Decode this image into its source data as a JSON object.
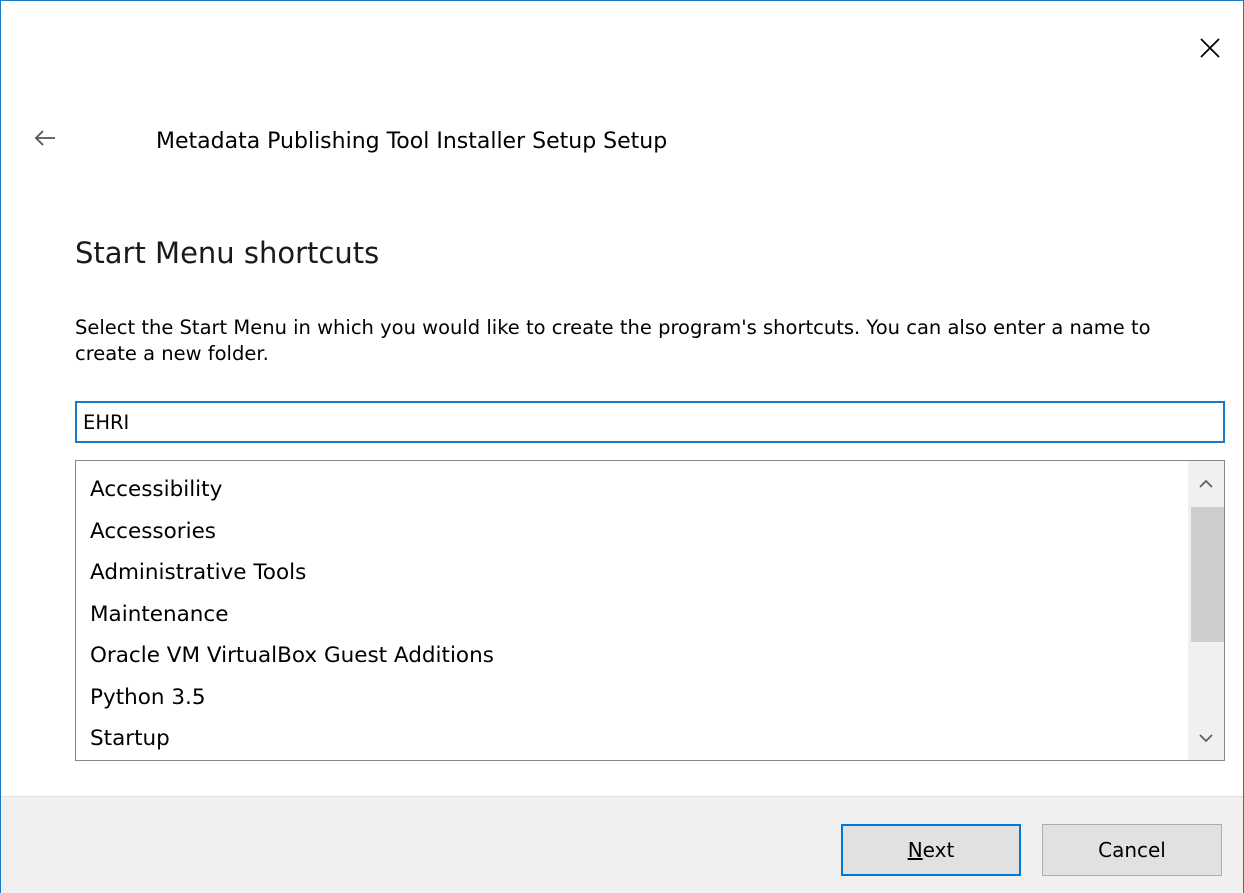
{
  "window": {
    "title": "Metadata Publishing Tool Installer Setup Setup",
    "close_icon": "close-icon",
    "back_icon": "back-arrow-icon",
    "accent_color": "#1979ca"
  },
  "page": {
    "heading": "Start Menu shortcuts",
    "description": "Select the Start Menu in which you would like to create the program's shortcuts. You can also enter a name to create a new folder."
  },
  "folder_input": {
    "value": "EHRI"
  },
  "folder_list": {
    "items": [
      {
        "label": "Accessibility"
      },
      {
        "label": "Accessories"
      },
      {
        "label": "Administrative Tools"
      },
      {
        "label": "Maintenance"
      },
      {
        "label": "Oracle VM VirtualBox Guest Additions"
      },
      {
        "label": "Python 3.5"
      },
      {
        "label": "Startup"
      }
    ],
    "scroll_up_icon": "chevron-up-icon",
    "scroll_down_icon": "chevron-down-icon"
  },
  "footer": {
    "next_mnemonic": "N",
    "next_rest": "ext",
    "cancel_label": "Cancel"
  }
}
